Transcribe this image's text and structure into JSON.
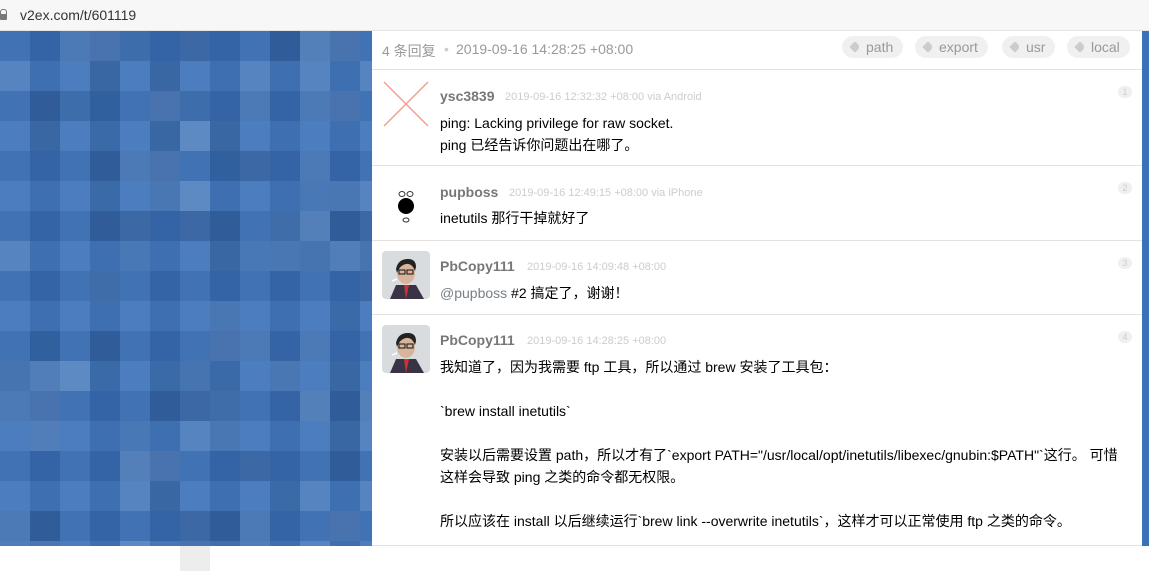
{
  "browser": {
    "url": "v2ex.com/t/601119"
  },
  "topic_header": {
    "reply_count": "4 条回复",
    "separator": "•",
    "last_reply_time": "2019-09-16 14:28:25 +08:00",
    "tags": [
      "path",
      "export",
      "usr",
      "local"
    ]
  },
  "replies": [
    {
      "author": "ysc3839",
      "meta": "2019-09-16 12:32:32 +08:00 via Android",
      "floor": "1",
      "lines": [
        "ping: Lacking privilege for raw socket.",
        "ping 已经告诉你问题出在哪了。"
      ]
    },
    {
      "author": "pupboss",
      "meta": "2019-09-16 12:49:15 +08:00 via iPhone",
      "floor": "2",
      "lines": [
        "inetutils 那行干掉就好了"
      ]
    },
    {
      "author": "PbCopy111",
      "meta": "2019-09-16 14:09:48 +08:00",
      "floor": "3",
      "mention": "@pupboss",
      "text": " #2 搞定了，谢谢！"
    },
    {
      "author": "PbCopy111",
      "meta": "2019-09-16 14:28:25 +08:00",
      "floor": "4",
      "lines": [
        "我知道了，因为我需要 ftp 工具，所以通过 brew 安装了工具包：",
        "`brew install inetutils`",
        "安装以后需要设置 path，所以才有了`export PATH=\"/usr/local/opt/inetutils/libexec/gnubin:$PATH\"`这行。 可惜这样会导致 ping 之类的命令都无权限。",
        "所以应该在 install 以后继续运行`brew link --overwrite inetutils`，这样才可以正常使用 ftp 之类的命令。"
      ]
    }
  ],
  "colors": {
    "background_blue": "#3a70b8",
    "meta_gray": "#cccccc",
    "author_gray": "#777777",
    "link_gray": "#778087"
  }
}
